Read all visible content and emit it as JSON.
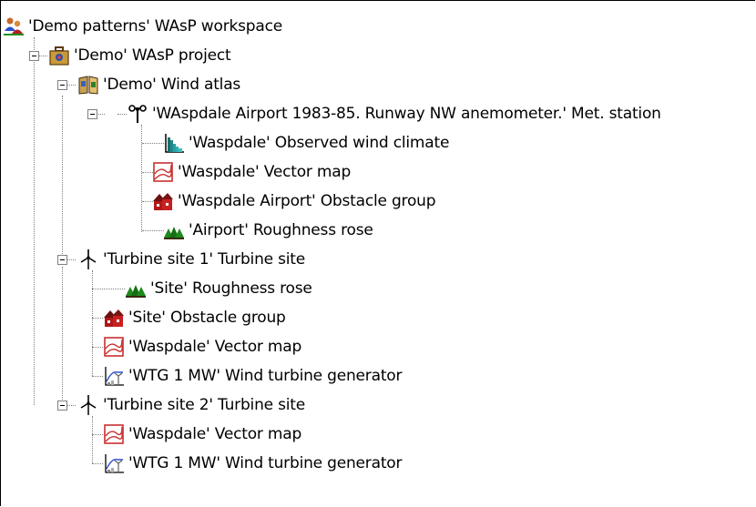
{
  "tree": {
    "workspace": {
      "label": "'Demo patterns' WAsP workspace",
      "icon": "workspace-icon"
    },
    "project": {
      "label": "'Demo' WAsP project",
      "icon": "project-briefcase-icon"
    },
    "atlas": {
      "label": "'Demo' Wind atlas",
      "icon": "wind-atlas-book-icon"
    },
    "met_station": {
      "label": "'WAspdale Airport 1983-85. Runway NW anemometer.' Met. station",
      "icon": "anemometer-icon"
    },
    "met_children": [
      {
        "label": "'Waspdale' Observed wind climate",
        "icon": "wind-climate-histogram-icon"
      },
      {
        "label": "'Waspdale' Vector map",
        "icon": "vector-map-icon"
      },
      {
        "label": "'Waspdale Airport' Obstacle group",
        "icon": "obstacle-group-icon"
      },
      {
        "label": "'Airport' Roughness rose",
        "icon": "roughness-rose-icon"
      }
    ],
    "site1": {
      "label": "'Turbine site 1' Turbine site",
      "icon": "turbine-site-icon"
    },
    "site1_children": [
      {
        "label": "'Site' Roughness rose",
        "icon": "roughness-rose-icon"
      },
      {
        "label": "'Site' Obstacle group",
        "icon": "obstacle-group-icon"
      },
      {
        "label": "'Waspdale' Vector map",
        "icon": "vector-map-icon"
      },
      {
        "label": "'WTG 1 MW' Wind turbine generator",
        "icon": "wind-turbine-generator-icon"
      }
    ],
    "site2": {
      "label": "'Turbine site 2' Turbine site",
      "icon": "turbine-site-icon"
    },
    "site2_children": [
      {
        "label": "'Waspdale' Vector map",
        "icon": "vector-map-icon"
      },
      {
        "label": "'WTG 1 MW' Wind turbine generator",
        "icon": "wind-turbine-generator-icon"
      }
    ]
  },
  "colors": {
    "tree_line": "#808080",
    "obstacle_red": "#b01818",
    "roughness_green": "#1e8a1e",
    "map_red": "#c83030"
  }
}
